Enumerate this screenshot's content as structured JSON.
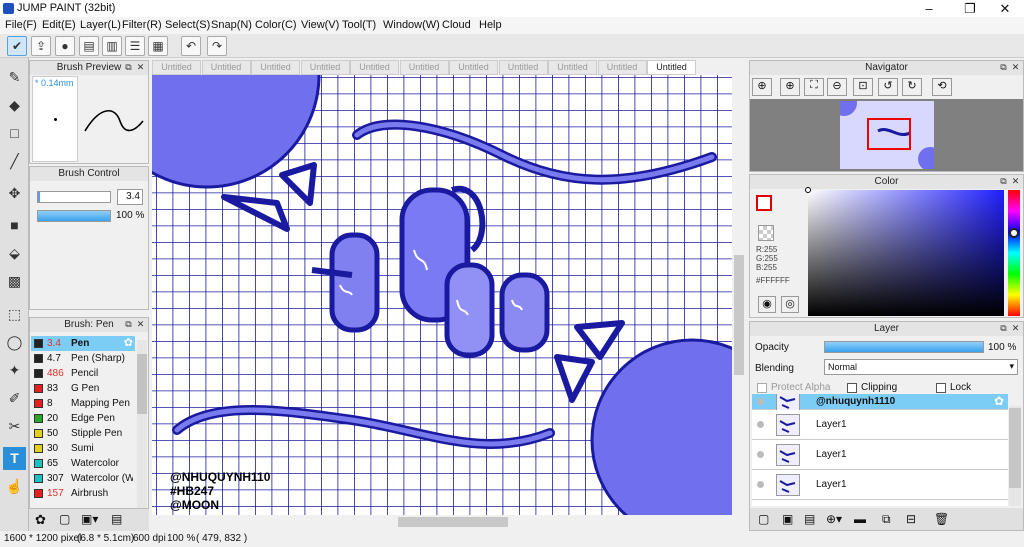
{
  "app": {
    "title": "JUMP PAINT (32bit)"
  },
  "window": {
    "minimize": "–",
    "maximize": "❐",
    "close": "✕"
  },
  "menu": [
    "File(F)",
    "Edit(E)",
    "Layer(L)",
    "Filter(R)",
    "Select(S)",
    "Snap(N)",
    "Color(C)",
    "View(V)",
    "Tool(T)",
    "Window(W)",
    "Cloud",
    "Help"
  ],
  "tabs": [
    "Untitled",
    "Untitled",
    "Untitled",
    "Untitled",
    "Untitled",
    "Untitled",
    "Untitled",
    "Untitled",
    "Untitled",
    "Untitled",
    "Untitled"
  ],
  "brush_preview": {
    "title": "Brush Preview",
    "size": "* 0.14mm"
  },
  "brush_control": {
    "title": "Brush Control",
    "size": "3.4",
    "opacity": "100 %",
    "opacity_value": 1.0
  },
  "brush_list": {
    "title": "Brush: Pen",
    "items": [
      {
        "size": "3.4",
        "name": "Pen",
        "color": "#222222",
        "size_color": "#e53030",
        "selected": true
      },
      {
        "size": "4.7",
        "name": "Pen (Sharp)",
        "color": "#222222",
        "size_color": "#111111"
      },
      {
        "size": "486",
        "name": "Pencil",
        "color": "#222222",
        "size_color": "#e53030"
      },
      {
        "size": "83",
        "name": "G Pen",
        "color": "#e52020",
        "size_color": "#111111"
      },
      {
        "size": "8",
        "name": "Mapping Pen",
        "color": "#e52020",
        "size_color": "#111111"
      },
      {
        "size": "20",
        "name": "Edge Pen",
        "color": "#2aa52a",
        "size_color": "#111111"
      },
      {
        "size": "50",
        "name": "Stipple Pen",
        "color": "#e0d020",
        "size_color": "#111111"
      },
      {
        "size": "30",
        "name": "Sumi",
        "color": "#e0d020",
        "size_color": "#111111"
      },
      {
        "size": "65",
        "name": "Watercolor",
        "color": "#20c0c0",
        "size_color": "#111111"
      },
      {
        "size": "307",
        "name": "Watercolor (W",
        "color": "#20c0c0",
        "size_color": "#111111"
      },
      {
        "size": "157",
        "name": "Airbrush",
        "color": "#e52020",
        "size_color": "#e53030"
      }
    ]
  },
  "canvas_text": [
    "@NHUQUYNH110",
    "#HB247",
    "@MOON"
  ],
  "navigator": {
    "title": "Navigator"
  },
  "color_panel": {
    "title": "Color",
    "r": "R:255",
    "g": "G:255",
    "b": "B:255",
    "hex": "#FFFFFF"
  },
  "layer_panel": {
    "title": "Layer",
    "opacity_label": "Opacity",
    "opacity": "100 %",
    "opacity_value": 1.0,
    "blending_label": "Blending",
    "blending": "Normal",
    "protect_alpha": "Protect Alpha",
    "clipping": "Clipping",
    "lock": "Lock",
    "layers": [
      {
        "name": "@nhuquynh1110",
        "selected": true
      },
      {
        "name": "Layer1"
      },
      {
        "name": "Layer1"
      },
      {
        "name": "Layer1"
      }
    ]
  },
  "status": {
    "size": "1600 * 1200 pixel",
    "mm": "(6.8 * 5.1cm)",
    "dpi": "600 dpi",
    "zoom": "100 %",
    "coords": "( 479, 832 )"
  },
  "colors": {
    "accent": "#7ccdf5",
    "canvas_blue": "#7070ee",
    "grid": "#1a1aa0"
  }
}
